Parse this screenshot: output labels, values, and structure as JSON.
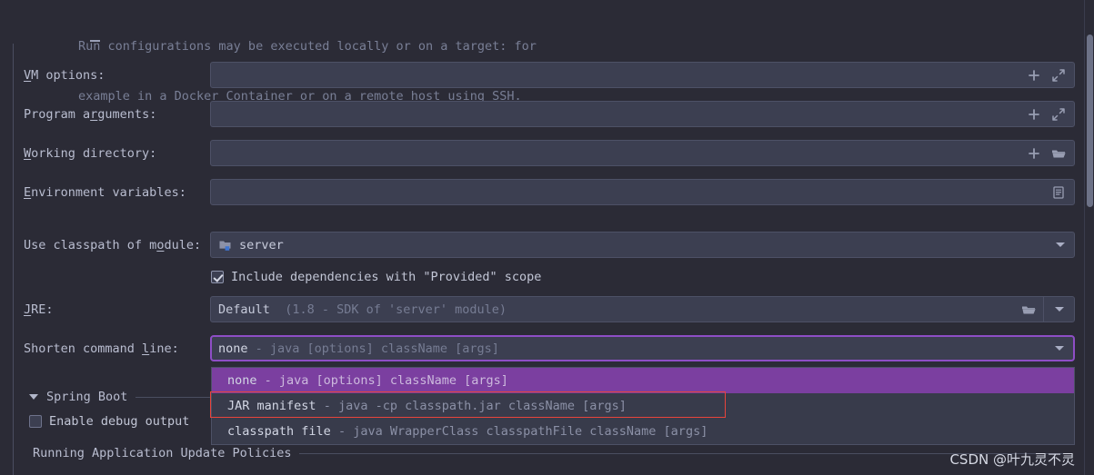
{
  "description": {
    "line1": "Run configurations may be executed locally or on a target: for",
    "line2": "example in a Docker Container or on a remote host using SSH."
  },
  "fields": {
    "vm_options": {
      "label_pre": "V",
      "label_mn": "M",
      "label_post": " options:",
      "label": "VM options:",
      "value": "",
      "placeholder": ""
    },
    "program_arguments": {
      "label": "Program arguments:",
      "value": "",
      "placeholder": ""
    },
    "working_directory": {
      "label": "Working directory:",
      "value": "",
      "placeholder": ""
    },
    "environment_variables": {
      "label": "Environment variables:",
      "value": "",
      "placeholder": ""
    },
    "use_classpath_of_module": {
      "label": "Use classpath of module:",
      "value": "server"
    },
    "include_provided": {
      "label": "Include dependencies with \"Provided\" scope",
      "checked": true
    },
    "jre": {
      "label": "JRE:",
      "value": "Default",
      "hint": "(1.8 - SDK of 'server' module)"
    },
    "shorten_command_line": {
      "label": "Shorten command line:",
      "value_bold": "none",
      "value_dim": "- java [options] className [args]"
    }
  },
  "dropdown": {
    "items": [
      {
        "name": "none",
        "detail": "- java [options] className [args]",
        "selected": true
      },
      {
        "name": "JAR manifest",
        "detail": "- java -cp classpath.jar className [args]",
        "selected": false
      },
      {
        "name": "classpath file",
        "detail": "- java WrapperClass classpathFile className [args]",
        "selected": false
      }
    ]
  },
  "sections": {
    "spring_boot": {
      "label": "Spring Boot",
      "expanded": true
    },
    "enable_debug_output": {
      "label": "Enable debug output",
      "checked": false
    },
    "running_application_update_policies": {
      "label": "Running Application Update Policies"
    }
  },
  "icons": {
    "add": "plus-icon",
    "expand": "expand-diagonal-icon",
    "folder": "folder-icon",
    "list": "list-editor-icon",
    "caret": "chevron-down-icon",
    "module": "module-folder-icon"
  },
  "colors": {
    "background": "#2b2b36",
    "field_bg": "#3c3f51",
    "accent_focus": "#8e4ec6",
    "selection": "#7b3fa0",
    "annotation": "#e8443c",
    "text": "#c7cbdb",
    "text_dim": "#8b90a6"
  },
  "watermark": {
    "text": "CSDN @叶九灵不灵"
  }
}
